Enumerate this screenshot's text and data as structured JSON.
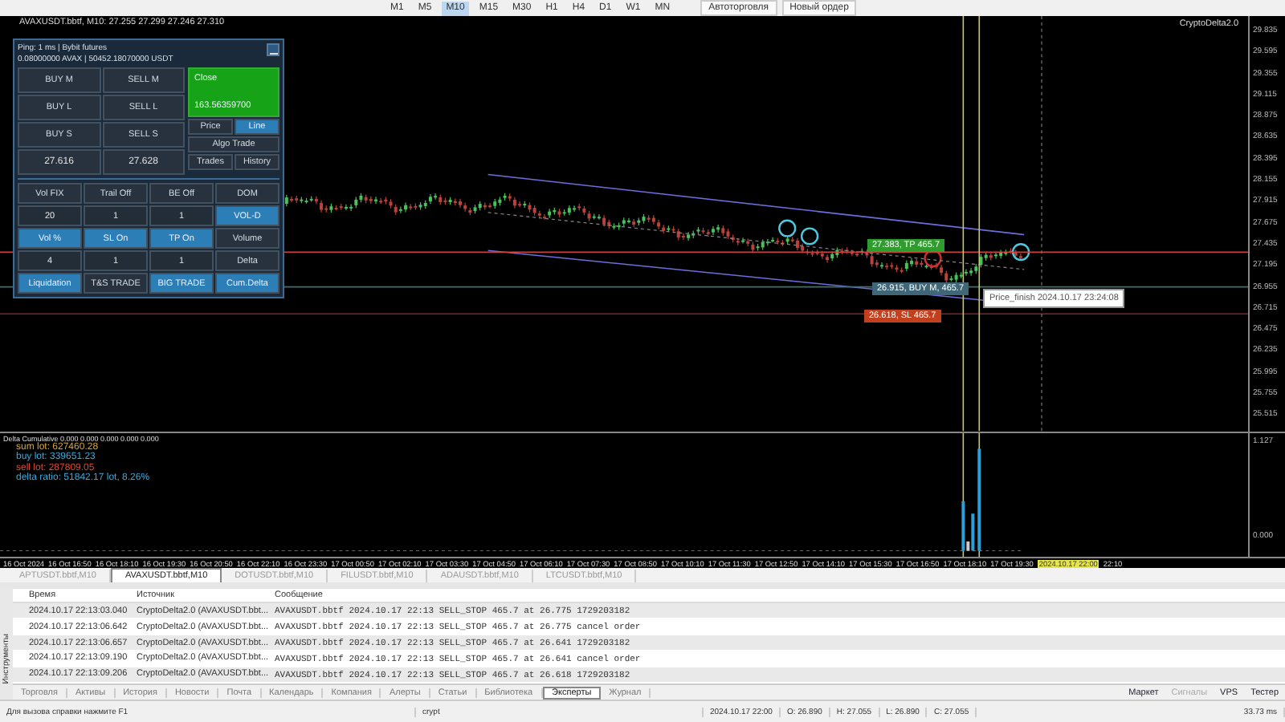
{
  "toolbar": {
    "timeframes": [
      {
        "label": "M1",
        "selected": false
      },
      {
        "label": "M5",
        "selected": false
      },
      {
        "label": "M10",
        "selected": true
      },
      {
        "label": "M15",
        "selected": false
      },
      {
        "label": "M30",
        "selected": false
      },
      {
        "label": "H1",
        "selected": false
      },
      {
        "label": "H4",
        "selected": false
      },
      {
        "label": "D1",
        "selected": false
      },
      {
        "label": "W1",
        "selected": false
      },
      {
        "label": "MN",
        "selected": false
      }
    ],
    "buttons": [
      "Автоторговля",
      "Новый ордер"
    ]
  },
  "chart": {
    "header": "AVAXUSDT.bbtf, M10: 27.255 27.299 27.246 27.310",
    "indicator_name": "CryptoDelta2.0",
    "price_labels": [
      "29.835",
      "29.595",
      "29.355",
      "29.115",
      "28.875",
      "28.635",
      "28.395",
      "28.155",
      "27.915",
      "27.675",
      "27.435",
      "27.195",
      "26.955",
      "26.715",
      "26.475",
      "26.235",
      "25.995",
      "25.755",
      "25.515"
    ],
    "trade_labels": [
      {
        "text": "27.383, TP 465.7",
        "kind": "tp"
      },
      {
        "text": "26.915, BUY M, 465.7",
        "kind": "entry"
      },
      {
        "text": "26.618, SL 465.7",
        "kind": "sl"
      }
    ],
    "tooltip": "Price_finish 2024.10.17 23:24:08"
  },
  "panel": {
    "status": "Ping: 1 ms | Bybit futures",
    "balance": "0.08000000 AVAX | 50452.18070000 USDT",
    "trade_buttons": [
      "BUY M",
      "SELL M",
      "BUY L",
      "SELL L",
      "BUY S",
      "SELL S"
    ],
    "prices": [
      "27.616",
      "27.628"
    ],
    "close": {
      "label": "Close",
      "value": "163.56359700"
    },
    "modes": [
      {
        "label": "Price",
        "selected": false
      },
      {
        "label": "Line",
        "selected": true
      }
    ],
    "algo": "Algo Trade",
    "views": [
      "Trades",
      "History"
    ],
    "grid": [
      {
        "label": "Vol FIX",
        "kind": "button",
        "on": false
      },
      {
        "label": "Trail Off",
        "kind": "button",
        "on": false
      },
      {
        "label": "BE Off",
        "kind": "button",
        "on": false
      },
      {
        "label": "DOM",
        "kind": "button",
        "on": false
      },
      {
        "label": "20",
        "kind": "value",
        "on": false
      },
      {
        "label": "1",
        "kind": "value",
        "on": false
      },
      {
        "label": "1",
        "kind": "value",
        "on": false
      },
      {
        "label": "VOL-D",
        "kind": "button",
        "on": true
      },
      {
        "label": "Vol %",
        "kind": "button",
        "on": true
      },
      {
        "label": "SL On",
        "kind": "button",
        "on": true
      },
      {
        "label": "TP On",
        "kind": "button",
        "on": true
      },
      {
        "label": "Volume",
        "kind": "button",
        "on": false
      },
      {
        "label": "4",
        "kind": "value",
        "on": false
      },
      {
        "label": "1",
        "kind": "value",
        "on": false
      },
      {
        "label": "1",
        "kind": "value",
        "on": false
      },
      {
        "label": "Delta",
        "kind": "button",
        "on": false
      },
      {
        "label": "Liquidation",
        "kind": "button",
        "on": true
      },
      {
        "label": "T&S TRADE",
        "kind": "button",
        "on": false
      },
      {
        "label": "BIG TRADE",
        "kind": "button",
        "on": true
      },
      {
        "label": "Cum.Delta",
        "kind": "button",
        "on": true
      }
    ]
  },
  "indicator": {
    "title": "Delta Cumulative 0.000 0.000 0.000 0.000 0.000",
    "stats": [
      {
        "text": "sum lot: 627460.28",
        "color": "#d9a53a"
      },
      {
        "text": "buy lot: 339651.23",
        "color": "#3aa8d9"
      },
      {
        "text": "sell lot: 287809.05",
        "color": "#d94a3a"
      },
      {
        "text": "delta ratio: 51842.17 lot, 8.26%",
        "color": "#3aa8d9"
      }
    ],
    "axis_labels": [
      "1.127",
      "0.000"
    ]
  },
  "time_axis": [
    {
      "text": "16 Oct 2024",
      "highlighted": false
    },
    {
      "text": "16 Oct 16:50",
      "highlighted": false
    },
    {
      "text": "16 Oct 18:10",
      "highlighted": false
    },
    {
      "text": "16 Oct 19:30",
      "highlighted": false
    },
    {
      "text": "16 Oct 20:50",
      "highlighted": false
    },
    {
      "text": "16 Oct 22:10",
      "highlighted": false
    },
    {
      "text": "16 Oct 23:30",
      "highlighted": false
    },
    {
      "text": "17 Oct 00:50",
      "highlighted": false
    },
    {
      "text": "17 Oct 02:10",
      "highlighted": false
    },
    {
      "text": "17 Oct 03:30",
      "highlighted": false
    },
    {
      "text": "17 Oct 04:50",
      "highlighted": false
    },
    {
      "text": "17 Oct 06:10",
      "highlighted": false
    },
    {
      "text": "17 Oct 07:30",
      "highlighted": false
    },
    {
      "text": "17 Oct 08:50",
      "highlighted": false
    },
    {
      "text": "17 Oct 10:10",
      "highlighted": false
    },
    {
      "text": "17 Oct 11:30",
      "highlighted": false
    },
    {
      "text": "17 Oct 12:50",
      "highlighted": false
    },
    {
      "text": "17 Oct 14:10",
      "highlighted": false
    },
    {
      "text": "17 Oct 15:30",
      "highlighted": false
    },
    {
      "text": "17 Oct 16:50",
      "highlighted": false
    },
    {
      "text": "17 Oct 18:10",
      "highlighted": false
    },
    {
      "text": "17 Oct 19:30",
      "highlighted": false
    },
    {
      "text": "2024.10.17 22:00",
      "highlighted": true
    },
    {
      "text": "22:10",
      "highlighted": false
    }
  ],
  "chart_tabs": [
    {
      "label": "APTUSDT.bbtf,M10",
      "selected": false
    },
    {
      "label": "AVAXUSDT.bbtf,M10",
      "selected": true
    },
    {
      "label": "DOTUSDT.bbtf,M10",
      "selected": false
    },
    {
      "label": "FILUSDT.bbtf,M10",
      "selected": false
    },
    {
      "label": "ADAUSDT.bbtf,M10",
      "selected": false
    },
    {
      "label": "LTCUSDT.bbtf,M10",
      "selected": false
    }
  ],
  "toolbox_title": "Инструменты",
  "log": {
    "columns": [
      "Время",
      "Источник",
      "Сообщение"
    ],
    "rows": [
      [
        "2024.10.17 22:13:03.040",
        "CryptoDelta2.0 (AVAXUSDT.bbt...",
        "AVAXUSDT.bbtf 2024.10.17 22:13 SELL_STOP 465.7 at 26.775 1729203182"
      ],
      [
        "2024.10.17 22:13:06.642",
        "CryptoDelta2.0 (AVAXUSDT.bbt...",
        "AVAXUSDT.bbtf 2024.10.17 22:13 SELL_STOP 465.7 at 26.775 cancel order"
      ],
      [
        "2024.10.17 22:13:06.657",
        "CryptoDelta2.0 (AVAXUSDT.bbt...",
        "AVAXUSDT.bbtf 2024.10.17 22:13 SELL_STOP 465.7 at 26.641 1729203182"
      ],
      [
        "2024.10.17 22:13:09.190",
        "CryptoDelta2.0 (AVAXUSDT.bbt...",
        "AVAXUSDT.bbtf 2024.10.17 22:13 SELL_STOP 465.7 at 26.641 cancel order"
      ],
      [
        "2024.10.17 22:13:09.206",
        "CryptoDelta2.0 (AVAXUSDT.bbt...",
        "AVAXUSDT.bbtf 2024.10.17 22:13 SELL_STOP 465.7 at 26.618 1729203182"
      ]
    ]
  },
  "terminal_tabs": [
    {
      "label": "Торговля",
      "selected": false
    },
    {
      "label": "Активы",
      "selected": false
    },
    {
      "label": "История",
      "selected": false
    },
    {
      "label": "Новости",
      "selected": false
    },
    {
      "label": "Почта",
      "selected": false
    },
    {
      "label": "Календарь",
      "selected": false
    },
    {
      "label": "Компания",
      "selected": false
    },
    {
      "label": "Алерты",
      "selected": false
    },
    {
      "label": "Статьи",
      "selected": false
    },
    {
      "label": "Библиотека",
      "selected": false
    },
    {
      "label": "Эксперты",
      "selected": true
    },
    {
      "label": "Журнал",
      "selected": false
    }
  ],
  "services": [
    {
      "label": "Маркет",
      "disabled": false
    },
    {
      "label": "Сигналы",
      "disabled": true
    },
    {
      "label": "VPS",
      "disabled": false
    },
    {
      "label": "Тестер",
      "disabled": false
    }
  ],
  "status_bar": {
    "help": "Для вызова справки нажмите F1",
    "profile": "crypt",
    "time": "2024.10.17 22:00",
    "open": "O: 26.890",
    "high": "H: 27.055",
    "low": "L: 26.890",
    "close": "C: 27.055",
    "ping": "33.73 ms"
  }
}
